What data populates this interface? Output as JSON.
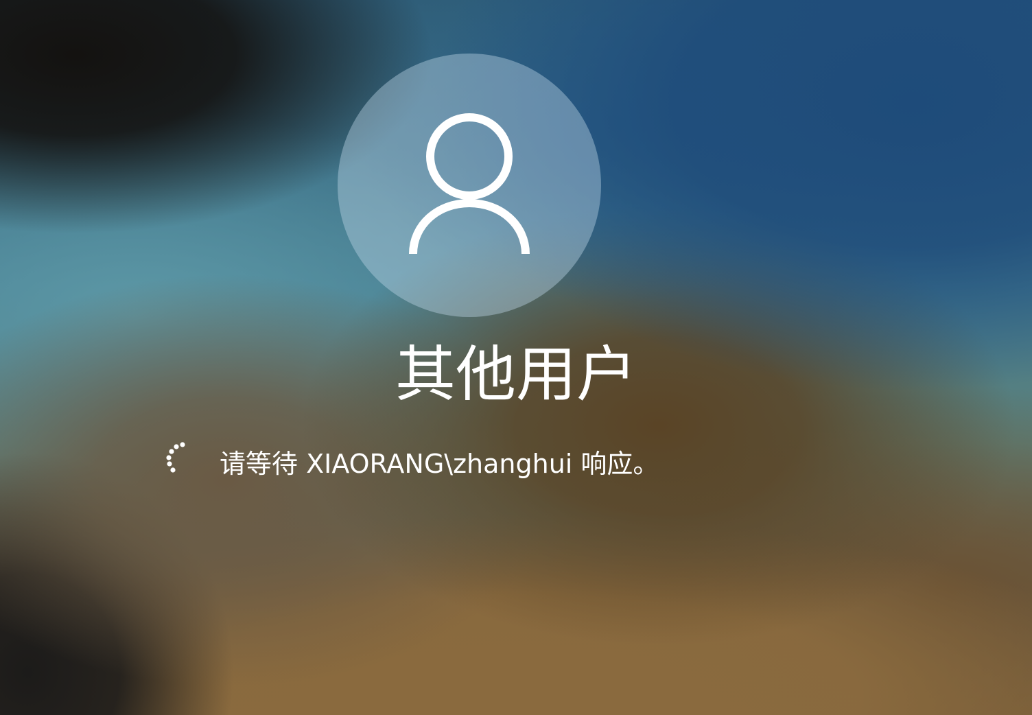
{
  "login": {
    "avatar_icon": "user-silhouette-icon",
    "user_name": "其他用户",
    "status_text": "请等待 XIAORANG\\zhanghui 响应。",
    "spinner_icon": "loading-spinner-icon"
  },
  "colors": {
    "text": "#ffffff",
    "avatar_background": "rgba(190,215,230,0.42)"
  }
}
